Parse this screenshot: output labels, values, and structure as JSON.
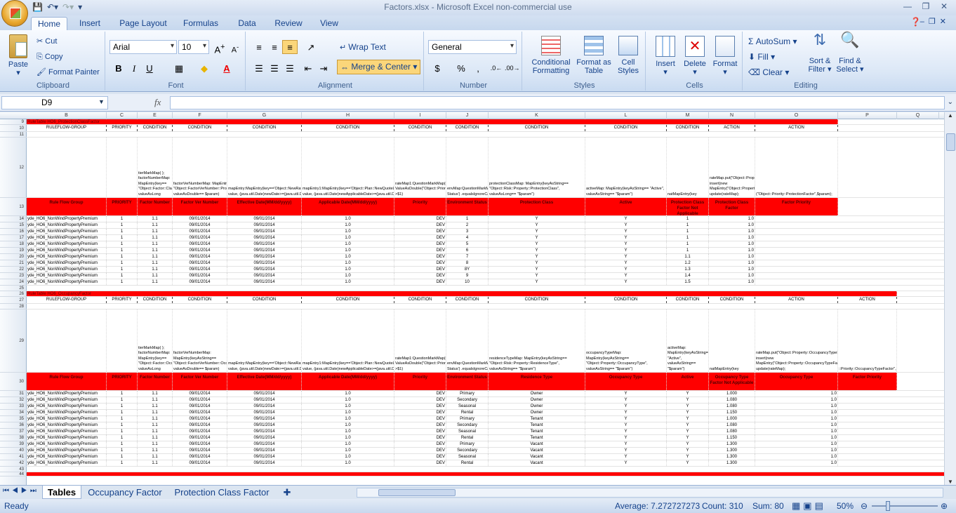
{
  "app": {
    "window_title": "Factors.xlsx - Microsoft Excel non-commercial use"
  },
  "ribbon": {
    "tabs": [
      "Home",
      "Insert",
      "Page Layout",
      "Formulas",
      "Data",
      "Review",
      "View"
    ],
    "clipboard": {
      "paste": "Paste",
      "cut": "Cut",
      "copy": "Copy",
      "format_painter": "Format Painter",
      "label": "Clipboard"
    },
    "font": {
      "name": "Arial",
      "size": "10",
      "label": "Font",
      "bold": "B",
      "italic": "I",
      "underline": "U"
    },
    "alignment": {
      "wrap": "Wrap Text",
      "merge": "Merge & Center",
      "label": "Alignment"
    },
    "number": {
      "format": "General",
      "currency": "$",
      "percent": "%",
      "comma": ",",
      "label": "Number"
    },
    "styles": {
      "conditional": "Conditional Formatting",
      "table": "Format as Table",
      "cell": "Cell Styles",
      "label": "Styles"
    },
    "cells": {
      "insert": "Insert",
      "delete": "Delete",
      "format": "Format",
      "label": "Cells"
    },
    "editing": {
      "autosum": "AutoSum",
      "fill": "Fill",
      "clear": "Clear",
      "sort": "Sort & Filter",
      "find": "Find & Select",
      "label": "Editing"
    }
  },
  "formula_bar": {
    "name_box": "D9",
    "fx": "fx",
    "value": ""
  },
  "columns": [
    "A",
    "B",
    "C",
    "E",
    "F",
    "G",
    "H",
    "I",
    "J",
    "K",
    "L",
    "M",
    "N",
    "O",
    "P",
    "Q"
  ],
  "table1": {
    "title": "RuleTable HO6_ProtectionClassFactor",
    "row10": [
      "RULEFLOW-GROUP",
      "PRIORITY",
      "CONDITION",
      "CONDITION",
      "CONDITION",
      "CONDITION",
      "CONDITION",
      "CONDITION",
      "CONDITION",
      "CONDITION",
      "CONDITION",
      "ACTION",
      "ACTION"
    ],
    "row12": [
      "",
      "",
      "tierMarkMap( ); factorNumberMap: MapEntry(key== \"Object::Factor::ClassFactor\", valueAsLong",
      "factorVerNumberMap: MapEntry(keyAsString== \"Object::FactorVerNumber::ProtectionClassFactor\", valueAsDouble== $param)",
      "mapEntry:MapEntry(key=='Object::NewRatingDate',newDate: value, (java.util.Date)newDate>=(java.util.Date)\"$param\")",
      "mapEntry1:MapEntry(key=='Object::Plan::NewQuoteLockDate',newApplicableDate: value, (java.util.Date)newApplicableDate>=(java.util.Date)\"$param\")",
      "rateMap1:QuestionMarkMap(rateMap1.get ValueAsDouble(\"Object::Priority::ProtectionFactor\") >$1)",
      "envMap:QuestionMarkMap(envMap.get('Environment Status') .equalsIgnoreCase(\"$param\"))",
      "protectionClassMap: MapEntry(keyAsString== \"Object::Risk::Property::ProtectionClass\", valueAsLong== \"$param\")",
      "activeMap: MapEntry(keyAsString== \"Active\", valueAsString== \"$param\")",
      "natMapEntry(key",
      "rateMap.put(\"Object::Property::ProtectionFactor\",\"\"+$param); insert(new MapEntry(\"Object::Property::ProtectionFactor\",\"\"+$param)); update(rateMap);",
      "(\"Object::Priority::ProtectionFactor\",$param);"
    ],
    "headers": [
      "Rule Flow Group",
      "PRIORITY",
      "Factor Number",
      "Factor Ver Number",
      "Effective Date(MM/dd/yyyy)",
      "Applicable Date(MM/dd/yyyy)",
      "Priority",
      "Environment Status",
      "Protection Class",
      "Active",
      "Protection Class Factor Not Applicable",
      "Protection Class Factor",
      "Factor Priority"
    ],
    "rows": [
      [
        "14",
        "yde_HO6_NonWindPropertyPremium",
        "1",
        "1.1",
        "09/01/2014",
        "09/01/2014",
        "1.0",
        "DEV",
        "1",
        "Y",
        "Y",
        "1",
        "1.0"
      ],
      [
        "15",
        "yde_HO6_NonWindPropertyPremium",
        "1",
        "1.1",
        "09/01/2014",
        "09/01/2014",
        "1.0",
        "DEV",
        "2",
        "Y",
        "Y",
        "1",
        "1.0"
      ],
      [
        "16",
        "yde_HO6_NonWindPropertyPremium",
        "1",
        "1.1",
        "09/01/2014",
        "09/01/2014",
        "1.0",
        "DEV",
        "3",
        "Y",
        "Y",
        "1",
        "1.0"
      ],
      [
        "17",
        "yde_HO6_NonWindPropertyPremium",
        "1",
        "1.1",
        "09/01/2014",
        "09/01/2014",
        "1.0",
        "DEV",
        "4",
        "Y",
        "Y",
        "1",
        "1.0"
      ],
      [
        "18",
        "yde_HO6_NonWindPropertyPremium",
        "1",
        "1.1",
        "09/01/2014",
        "09/01/2014",
        "1.0",
        "DEV",
        "5",
        "Y",
        "Y",
        "1",
        "1.0"
      ],
      [
        "19",
        "yde_HO6_NonWindPropertyPremium",
        "1",
        "1.1",
        "09/01/2014",
        "09/01/2014",
        "1.0",
        "DEV",
        "6",
        "Y",
        "Y",
        "1",
        "1.0"
      ],
      [
        "20",
        "yde_HO6_NonWindPropertyPremium",
        "1",
        "1.1",
        "09/01/2014",
        "09/01/2014",
        "1.0",
        "DEV",
        "7",
        "Y",
        "Y",
        "1.1",
        "1.0"
      ],
      [
        "21",
        "yde_HO6_NonWindPropertyPremium",
        "1",
        "1.1",
        "09/01/2014",
        "09/01/2014",
        "1.0",
        "DEV",
        "8",
        "Y",
        "Y",
        "1.2",
        "1.0"
      ],
      [
        "22",
        "yde_HO6_NonWindPropertyPremium",
        "1",
        "1.1",
        "09/01/2014",
        "09/01/2014",
        "1.0",
        "DEV",
        "8Y",
        "Y",
        "Y",
        "1.3",
        "1.0"
      ],
      [
        "23",
        "yde_HO6_NonWindPropertyPremium",
        "1",
        "1.1",
        "09/01/2014",
        "09/01/2014",
        "1.0",
        "DEV",
        "9",
        "Y",
        "Y",
        "1.4",
        "1.0"
      ],
      [
        "24",
        "yde_HO6_NonWindPropertyPremium",
        "1",
        "1.1",
        "09/01/2014",
        "09/01/2014",
        "1.0",
        "DEV",
        "10",
        "Y",
        "Y",
        "1.5",
        "1.0"
      ]
    ]
  },
  "table2": {
    "title": "RuleTable HO6_OccupancyFactor",
    "row27": [
      "RULEFLOW-GROUP",
      "PRIORITY",
      "CONDITION",
      "CONDITION",
      "CONDITION",
      "CONDITION",
      "CONDITION",
      "CONDITION",
      "CONDITION",
      "CONDITION",
      "CONDITION",
      "CONDITION",
      "ACTION",
      "ACTION"
    ],
    "row29": [
      "",
      "",
      "tierMarkMap( ); factorNumberMap: MapEntry(key== \"Object::Factor::OccupancyType\", valueAsLong",
      "factorVerNumberMap: MapEntry(keyAsString== \"Object::FactorVerNumber::OccupancyType\", valueAsDouble== $param)",
      "mapEntry:MapEntry(key=='Object::NewRatingDate',newDate: value, (java.util.Date)newDate>=(java.util.Date)\"$param\")",
      "mapEntry1:MapEntry(key=='Object::Plan::NewQuoteLockDate',newApplicableDate: value, (java.util.Date)newApplicableDate>=(java.util.Date)\"$param\")",
      "rateMap1:QuestionMarkMap(rateMap1.get ValueAsDouble(\"Object::Priority::OccupancyTypeFactor\") >$1)",
      "envMap:QuestionMarkMap(envMap.get('Environment Status') .equalsIgnoreCase(\"$param\"))",
      "residenceTypeMap: MapEntry(keyAsString== \"Object::Risk::Property::ResidenceType\", valueAsString== \"$param\")",
      "occupancyTypeMap: MapEntry(keyAsString== \"Object::Property::OccupancyType\", valueAsString== \"$param\")",
      "activeMap: MapEntry(keyAsString== \"Active\", valueAsString== \"$param\")",
      "natMapEntry(key",
      "rateMap.put(\"Object::Property::OccupancyTypeFactor\",\"\"+$param); insert(new MapEntry(\"Object::Property::OccupancyTypeFactor\",\"\"+$param)); update(rateMap);",
      "::Priority::OccupancyTypeFactor\",$param);"
    ],
    "headers": [
      "Rule Flow Group",
      "PRIORITY",
      "Factor Number",
      "Factor Ver Number",
      "Effective Date(MM/dd/yyyy)",
      "Applicable Date(MM/dd/yyyy)",
      "Priority",
      "Environment Status",
      "Residence Type",
      "Occupancy Type",
      "Active",
      "Occupancy Type Factor Not Applicable",
      "Occupancy Type",
      "Factor Priority"
    ],
    "rows": [
      [
        "31",
        "yde_HO6_NonWindPropertyPremium",
        "1",
        "1.1",
        "09/01/2014",
        "09/01/2014",
        "1.0",
        "DEV",
        "Primary",
        "Owner",
        "Y",
        "Y",
        "1.000",
        "1.0"
      ],
      [
        "32",
        "yde_HO6_NonWindPropertyPremium",
        "1",
        "1.1",
        "09/01/2014",
        "09/01/2014",
        "1.0",
        "DEV",
        "Secondary",
        "Owner",
        "Y",
        "Y",
        "1.080",
        "1.0"
      ],
      [
        "33",
        "yde_HO6_NonWindPropertyPremium",
        "1",
        "1.1",
        "09/01/2014",
        "09/01/2014",
        "1.0",
        "DEV",
        "Seasonal",
        "Owner",
        "Y",
        "Y",
        "1.080",
        "1.0"
      ],
      [
        "34",
        "yde_HO6_NonWindPropertyPremium",
        "1",
        "1.1",
        "09/01/2014",
        "09/01/2014",
        "1.0",
        "DEV",
        "Rental",
        "Owner",
        "Y",
        "Y",
        "1.150",
        "1.0"
      ],
      [
        "35",
        "yde_HO6_NonWindPropertyPremium",
        "1",
        "1.1",
        "09/01/2014",
        "09/01/2014",
        "1.0",
        "DEV",
        "Primary",
        "Tenant",
        "Y",
        "Y",
        "1.000",
        "1.0"
      ],
      [
        "36",
        "yde_HO6_NonWindPropertyPremium",
        "1",
        "1.1",
        "09/01/2014",
        "09/01/2014",
        "1.0",
        "DEV",
        "Secondary",
        "Tenant",
        "Y",
        "Y",
        "1.080",
        "1.0"
      ],
      [
        "37",
        "yde_HO6_NonWindPropertyPremium",
        "1",
        "1.1",
        "09/01/2014",
        "09/01/2014",
        "1.0",
        "DEV",
        "Seasonal",
        "Tenant",
        "Y",
        "Y",
        "1.080",
        "1.0"
      ],
      [
        "38",
        "yde_HO6_NonWindPropertyPremium",
        "1",
        "1.1",
        "09/01/2014",
        "09/01/2014",
        "1.0",
        "DEV",
        "Rental",
        "Tenant",
        "Y",
        "Y",
        "1.150",
        "1.0"
      ],
      [
        "39",
        "yde_HO6_NonWindPropertyPremium",
        "1",
        "1.1",
        "09/01/2014",
        "09/01/2014",
        "1.0",
        "DEV",
        "Primary",
        "Vacant",
        "Y",
        "Y",
        "1.300",
        "1.0"
      ],
      [
        "40",
        "yde_HO6_NonWindPropertyPremium",
        "1",
        "1.1",
        "09/01/2014",
        "09/01/2014",
        "1.0",
        "DEV",
        "Secondary",
        "Vacant",
        "Y",
        "Y",
        "1.300",
        "1.0"
      ],
      [
        "41",
        "yde_HO6_NonWindPropertyPremium",
        "1",
        "1.1",
        "09/01/2014",
        "09/01/2014",
        "1.0",
        "DEV",
        "Seasonal",
        "Vacant",
        "Y",
        "Y",
        "1.300",
        "1.0"
      ],
      [
        "42",
        "yde_HO6_NonWindPropertyPremium",
        "1",
        "1.1",
        "09/01/2014",
        "09/01/2014",
        "1.0",
        "DEV",
        "Rental",
        "Vacant",
        "Y",
        "Y",
        "1.300",
        "1.0"
      ]
    ]
  },
  "sheet_tabs": [
    "Tables",
    "Occupancy Factor",
    "Protection Class Factor"
  ],
  "status": {
    "ready": "Ready",
    "average": "Average: 7.272727273",
    "count": "Count: 310",
    "sum": "Sum: 80",
    "zoom": "50%"
  }
}
